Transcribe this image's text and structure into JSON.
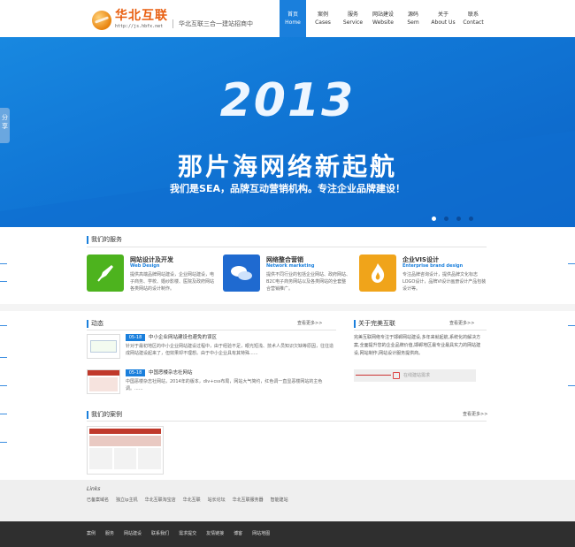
{
  "header": {
    "logo_cn": "华北互联",
    "logo_url": "http://js.hbfx.net",
    "slogan": "华北互联三合一建站招商中",
    "nav": [
      {
        "cn": "首页",
        "en": "Home",
        "active": true
      },
      {
        "cn": "案例",
        "en": "Cases"
      },
      {
        "cn": "服务",
        "en": "Service"
      },
      {
        "cn": "网站建设",
        "en": "Website"
      },
      {
        "cn": "源码",
        "en": "Sem"
      },
      {
        "cn": "关于",
        "en": "About Us"
      },
      {
        "cn": "联系",
        "en": "Contact"
      }
    ]
  },
  "banner": {
    "year": "2013",
    "headline": "那片海网络新起航",
    "subline": "我们是SEA，品牌互动营销机构。专注企业品牌建设！",
    "dots": 4,
    "active_dot": 0
  },
  "share_tab": "分享",
  "services": {
    "title": "我们的服务",
    "items": [
      {
        "title": "网站设计及开发",
        "en": "Web Design",
        "desc": "提供高端品牌网站建设，企业网站建设，电子商务、学校、婚纱影楼、医院及政府网站各类网站的设计制作。",
        "color": "#4db31e",
        "icon": "rocket-icon"
      },
      {
        "title": "网络整合营销",
        "en": "Network marketing",
        "desc": "提供不同行业的包括企业网站、政府网站、B2C电子商务网站以及各类网站的全套整合营销推广。",
        "color": "#1f6ad0",
        "icon": "chat-bubbles-icon"
      },
      {
        "title": "企业VIS设计",
        "en": "Enterprise brand design",
        "desc": "专注品牌咨询设计，提供品牌文化标志LOGO设计，品牌VI设计画册设计产品包装设计等。",
        "color": "#f0a41a",
        "icon": "flame-icon"
      }
    ]
  },
  "news": {
    "title": "动态",
    "more": "查看更多>>",
    "items": [
      {
        "date": "05-18",
        "title": "中小企业网站建设也避免的误区",
        "desc": "针对于最初地区的中小企业网站建设过程中，由于经验不足，眼光短浅、技术人员知识欠缺等原因，往往造成网站建设起来了，但效果却不理想。由于中小企业具有其特殊......"
      },
      {
        "date": "05-18",
        "title": "中国恶楼杂志社网站",
        "desc": "中国恶楼杂志社网站，2014年的版本，div+css布局，网站大气简约，红色调一直显恶楼网站的主色调。......"
      }
    ]
  },
  "about": {
    "title": "关于完美互联",
    "more": "查看更多>>",
    "text": "完美互联网络专注于邯郸网站建设,多年来就起航,系统化的解决方案,全面提升您的企业品牌价值,邯郸地区最专业最具实力的网站建设,网站制作,网站设计服务提供商。",
    "consult": "在线建站需求"
  },
  "cases": {
    "title": "我们的案例",
    "more": "查看更多>>"
  },
  "links": {
    "title": "Links",
    "items": [
      "已备案域名",
      "独立ip主机",
      "华北互联淘宝店",
      "华北互联",
      "站长论坛",
      "华北互联服务器",
      "智能建站"
    ]
  },
  "footer": {
    "items": [
      "案例",
      "服务",
      "网站建设",
      "联系我们",
      "需求提交",
      "友情链接",
      "博客",
      "网站地图"
    ]
  }
}
